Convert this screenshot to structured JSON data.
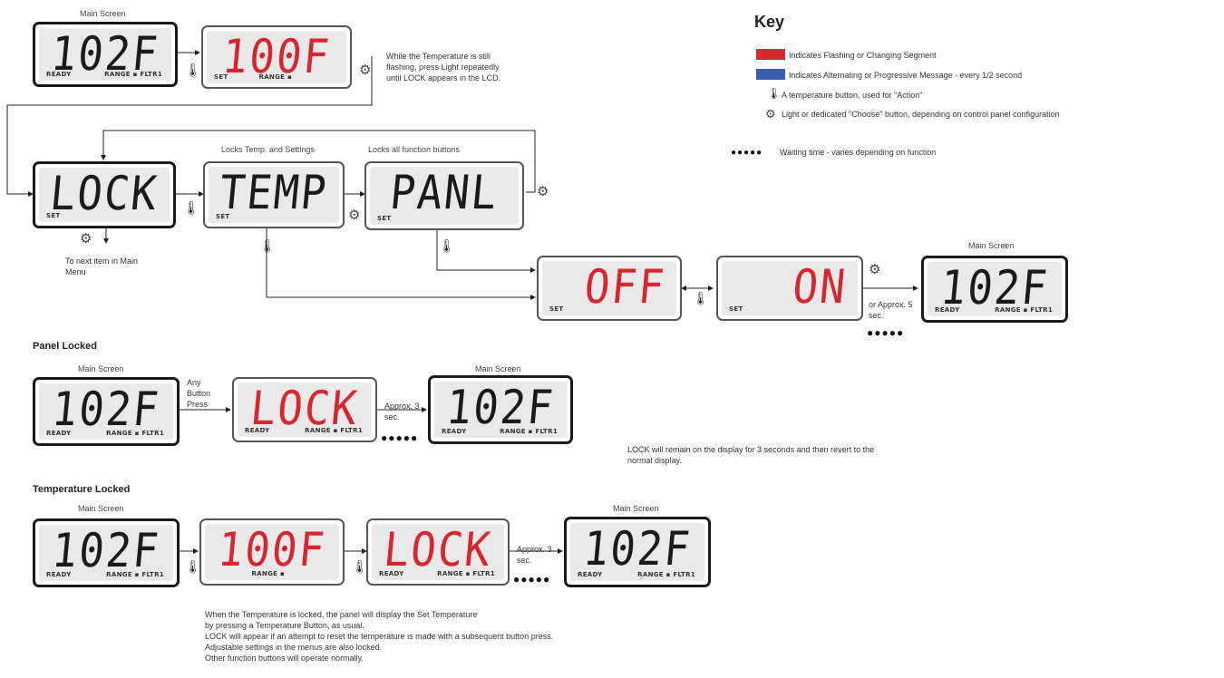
{
  "colors": {
    "flashing": "#d7262e",
    "alternating": "#3a5fb0"
  },
  "top": {
    "main_screen_label": "Main Screen",
    "lcd1": {
      "text": "102F",
      "left": "READY",
      "right": "RANGE ▪ FLTR1"
    },
    "lcd2": {
      "text": "100F",
      "left": "SET",
      "right": "RANGE ▪"
    },
    "note": "While the Temperature is still flashing, press Light repeatedly until LOCK appears in the LCD.",
    "lock": {
      "text": "LOCK",
      "left": "SET"
    },
    "temp": {
      "text": "TEMP",
      "left": "SET",
      "caption": "Locks Temp. and Settings"
    },
    "panl": {
      "text": "PANL",
      "left": "SET",
      "caption": "Locks all function buttons"
    },
    "next_item": "To next item in Main Menu",
    "off": {
      "text": "OFF",
      "left": "SET"
    },
    "on": {
      "text": "ON",
      "left": "SET"
    },
    "or_approx": "or Approx. 5 sec.",
    "main_screen_label2": "Main Screen",
    "lcd_final": {
      "text": "102F",
      "left": "READY",
      "right": "RANGE ▪ FLTR1"
    }
  },
  "key": {
    "title": "Key",
    "items": [
      "Indicates Flashing or Changing Segment",
      "Indicates Alternating or Progressive Message - every 1/2 second",
      "A temperature button, used for \"Action\"",
      "Light or dedicated \"Choose\" button, depending on control panel configuration"
    ],
    "waiting": "Waiting time - varies depending on function"
  },
  "panel_locked": {
    "title": "Panel Locked",
    "main_screen_label": "Main Screen",
    "lcd1": {
      "text": "102F",
      "left": "READY",
      "right": "RANGE ▪ FLTR1"
    },
    "any_button": "Any Button Press",
    "lcd2": {
      "text": "LOCK",
      "left": "READY",
      "right": "RANGE ▪ FLTR1"
    },
    "approx": "Approx. 3 sec.",
    "main_screen_label2": "Main Screen",
    "lcd3": {
      "text": "102F",
      "left": "READY",
      "right": "RANGE ▪ FLTR1"
    },
    "note": "LOCK will remain on the display for 3 seconds and then revert to the normal display."
  },
  "temp_locked": {
    "title": "Temperature Locked",
    "main_screen_label": "Main Screen",
    "lcd1": {
      "text": "102F",
      "left": "READY",
      "right": "RANGE ▪ FLTR1"
    },
    "lcd2": {
      "text": "100F",
      "left": "",
      "right": "RANGE ▪"
    },
    "lcd3": {
      "text": "LOCK",
      "left": "READY",
      "right": "RANGE ▪ FLTR1"
    },
    "approx": "Approx. 3 sec.",
    "main_screen_label2": "Main Screen",
    "lcd4": {
      "text": "102F",
      "left": "READY",
      "right": "RANGE ▪ FLTR1"
    },
    "notes": [
      "When the Temperature is locked, the panel will display the Set Temperature",
      "by pressing a Temperature Button, as usual.",
      "LOCK will appear if an attempt to reset the temperature is made with a subsequent button press.",
      "Adjustable settings in the menus are also locked.",
      "Other function buttons will operate normally."
    ]
  }
}
